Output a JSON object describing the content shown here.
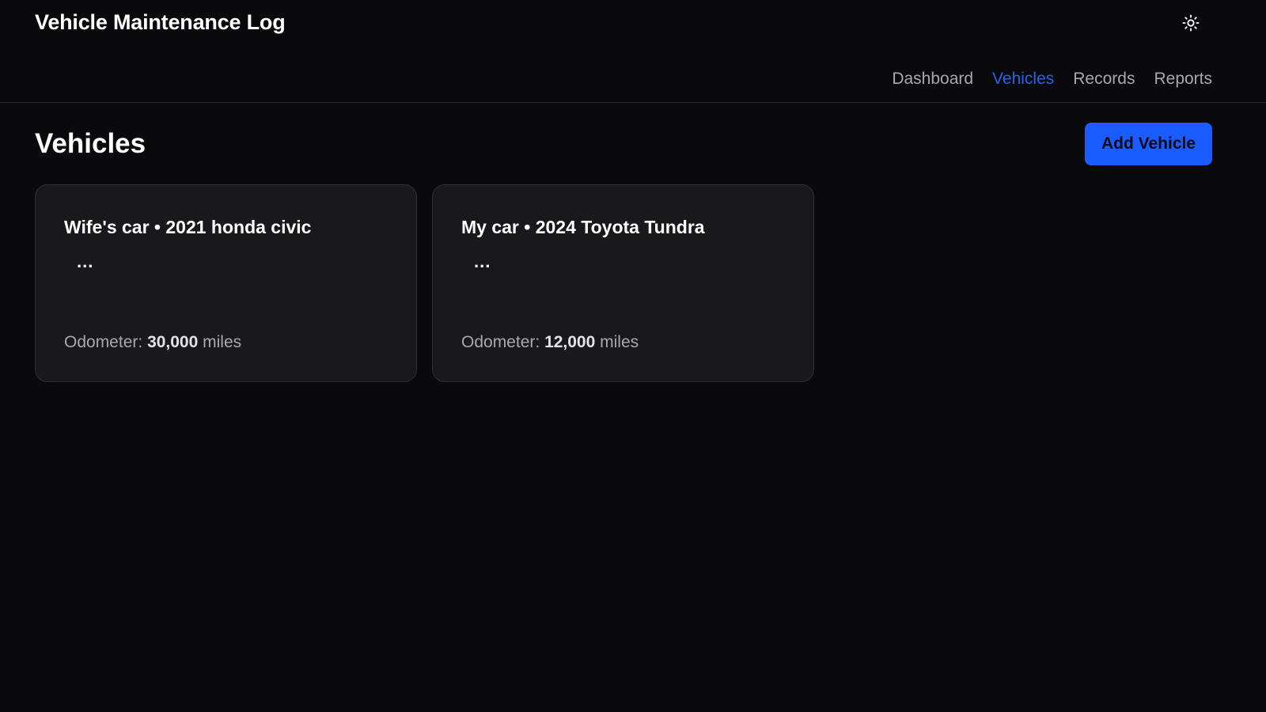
{
  "app": {
    "title": "Vehicle Maintenance Log",
    "theme_toggle_icon": "sun-icon"
  },
  "nav": {
    "items": [
      {
        "label": "Dashboard",
        "active": false
      },
      {
        "label": "Vehicles",
        "active": true
      },
      {
        "label": "Records",
        "active": false
      },
      {
        "label": "Reports",
        "active": false
      }
    ]
  },
  "page": {
    "title": "Vehicles",
    "add_button_label": "Add Vehicle"
  },
  "vehicles": [
    {
      "title": "Wife's car • 2021 honda civic",
      "menu_label": "...",
      "odometer_label": "Odometer:",
      "odometer_value": "30,000",
      "odometer_unit": "miles"
    },
    {
      "title": "My car • 2024 Toyota Tundra",
      "menu_label": "...",
      "odometer_label": "Odometer:",
      "odometer_value": "12,000",
      "odometer_unit": "miles"
    }
  ],
  "colors": {
    "background": "#0a0a0c",
    "card": "#19191c",
    "accent": "#1a5cff",
    "nav_active": "#2563eb"
  }
}
